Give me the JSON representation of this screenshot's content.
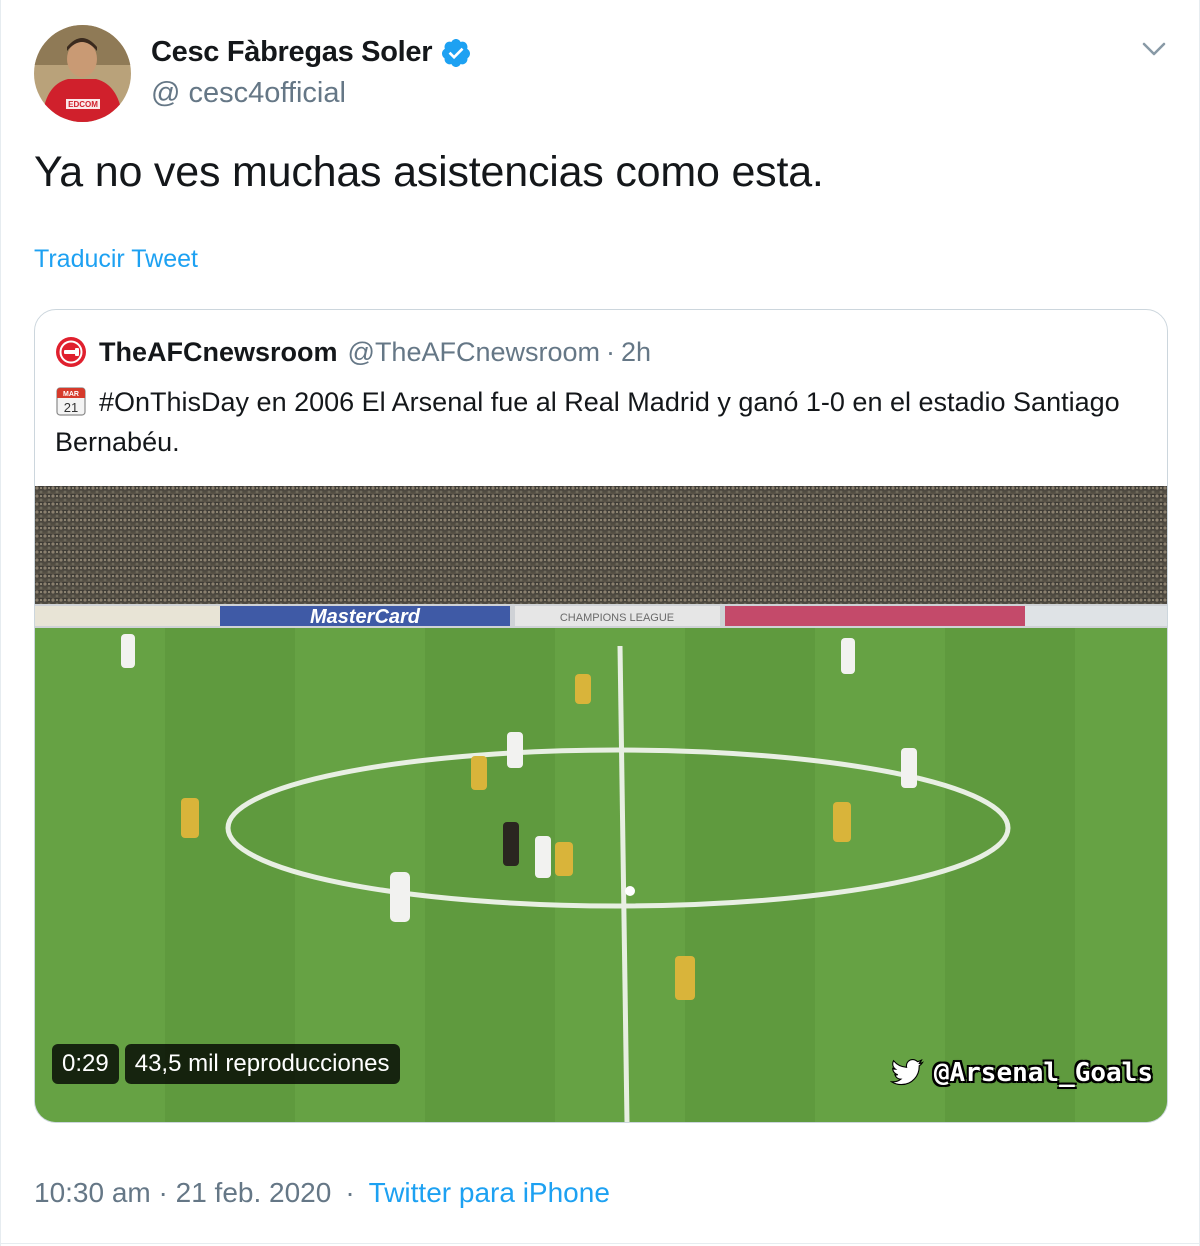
{
  "author": {
    "display_name": "Cesc Fàbregas Soler",
    "handle": "@ cesc4official",
    "verified_icon": "verified-badge-icon",
    "avatar_jersey_text": "EDCOM"
  },
  "tweet": {
    "text": "Ya no ves muchas asistencias como esta.",
    "translate_label": "Traducir Tweet"
  },
  "quoted": {
    "display_name": "TheAFCnewsroom",
    "handle": "@TheAFCnewsroom",
    "separator": "·",
    "time": "2h",
    "calendar_month": "MAR",
    "calendar_day": "21",
    "text": "#OnThisDay en 2006 El Arsenal fue al Real Madrid y ganó 1-0 en el estadio Santiago Bernabéu.",
    "video": {
      "duration": "0:29",
      "views": "43,5 mil reproducciones",
      "watermark": "@Arsenal_Goals",
      "board_ads": [
        "MasterCard",
        "CHAMPIONS LEAGUE"
      ]
    }
  },
  "meta": {
    "timestamp": "10:30 am · 21 feb. 2020",
    "dot": "·",
    "source": "Twitter para iPhone"
  },
  "colors": {
    "accent": "#1da1f2",
    "muted": "#657786",
    "text": "#14171a"
  }
}
